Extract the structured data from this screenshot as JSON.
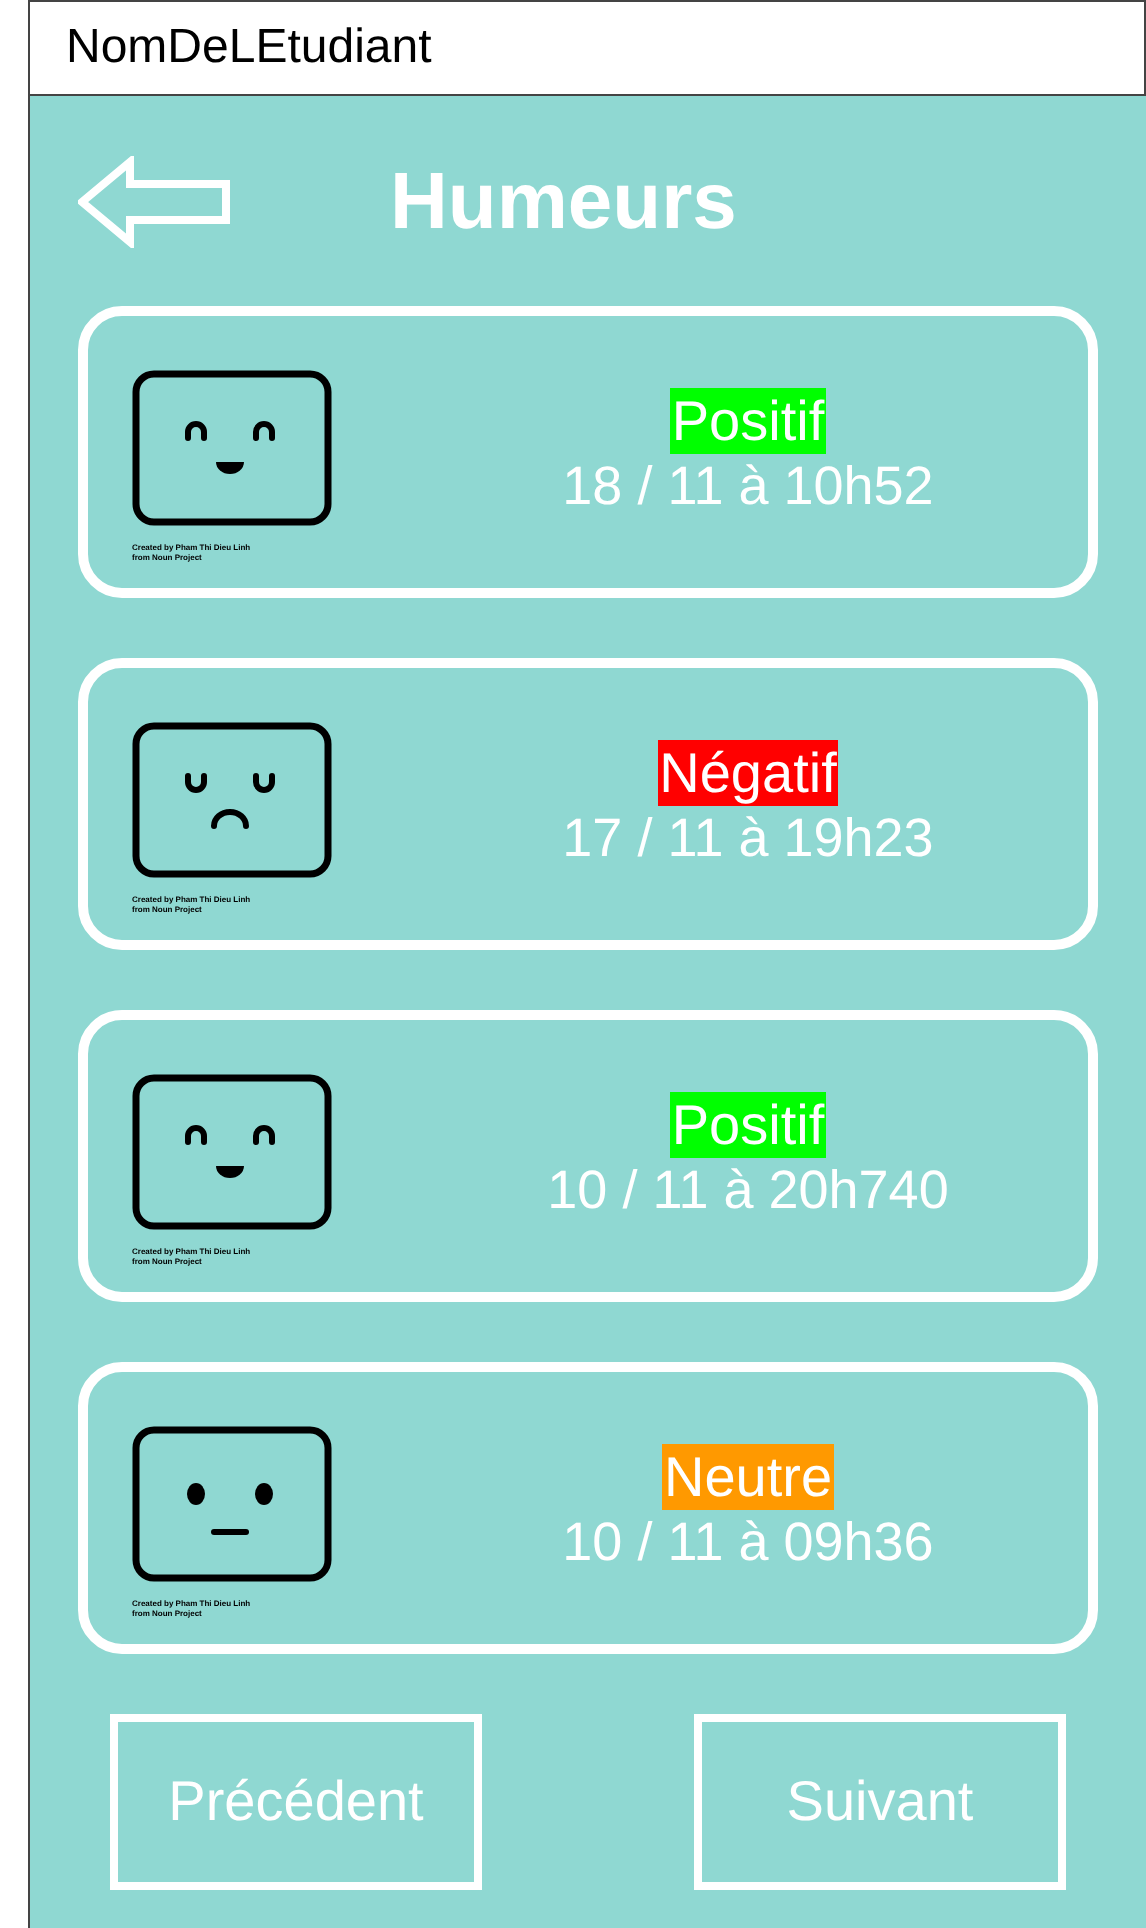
{
  "window": {
    "title": "NomDeLEtudiant"
  },
  "header": {
    "title": "Humeurs"
  },
  "moods": [
    {
      "kind": "happy",
      "label": "Positif",
      "color": "#00ff00",
      "date": "18 / 11 à 10h52",
      "credit": [
        "Created by Pham Thi Dieu Linh",
        "from Noun Project"
      ]
    },
    {
      "kind": "sad",
      "label": "Négatif",
      "color": "#ff0000",
      "date": "17 / 11 à 19h23",
      "credit": [
        "Created by Pham Thi Dieu Linh",
        "from Noun Project"
      ]
    },
    {
      "kind": "happy",
      "label": "Positif",
      "color": "#00ff00",
      "date": "10 / 11 à 20h740",
      "credit": [
        "Created by Pham Thi Dieu Linh",
        "from Noun Project"
      ]
    },
    {
      "kind": "neutral",
      "label": "Neutre",
      "color": "#ff9900",
      "date": "10 / 11 à 09h36",
      "credit": [
        "Created by Pham Thi Dieu Linh",
        "from Noun Project"
      ]
    }
  ],
  "buttons": [
    "Précédent",
    "Suivant"
  ]
}
